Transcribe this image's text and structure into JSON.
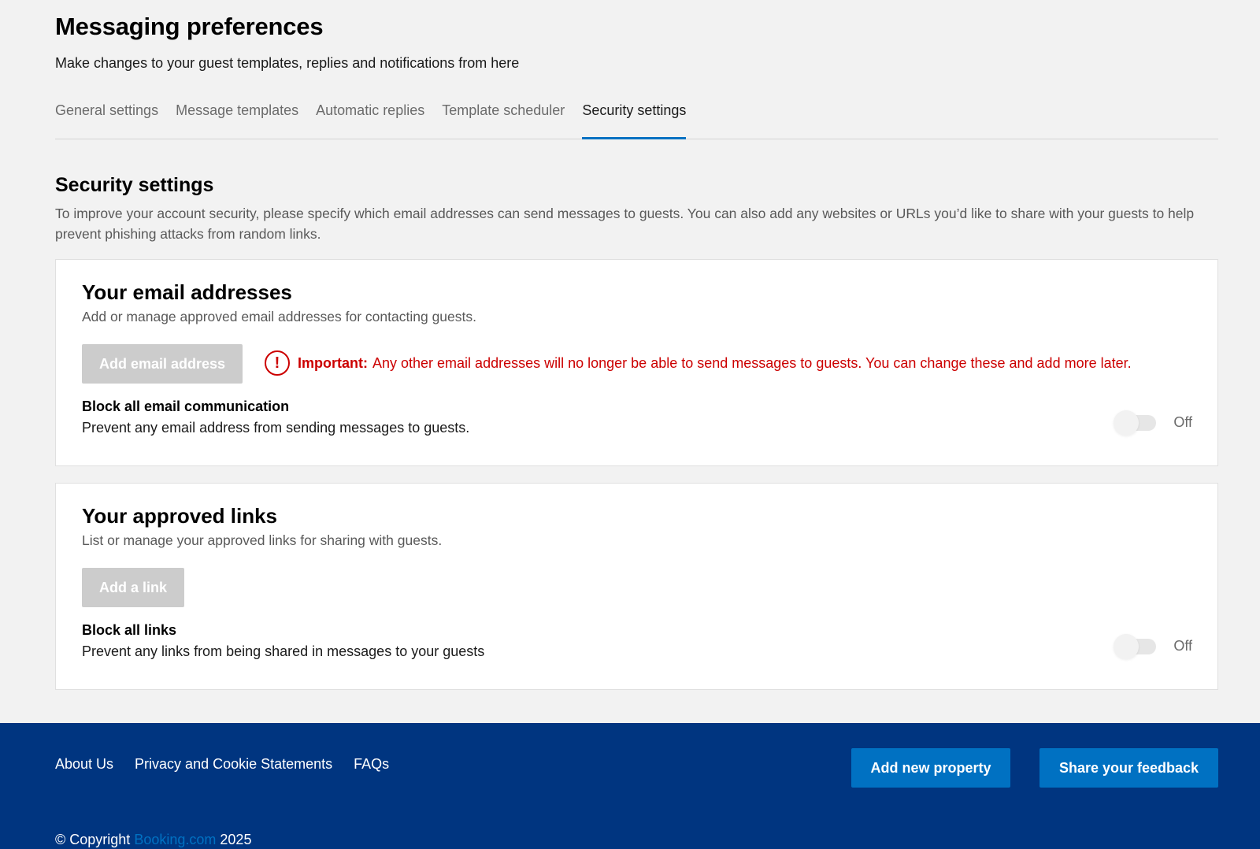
{
  "header": {
    "title": "Messaging preferences",
    "subtitle": "Make changes to your guest templates, replies and notifications from here"
  },
  "tabs": [
    {
      "label": "General settings"
    },
    {
      "label": "Message templates"
    },
    {
      "label": "Automatic replies"
    },
    {
      "label": "Template scheduler"
    },
    {
      "label": "Security settings",
      "active": true
    }
  ],
  "section": {
    "title": "Security settings",
    "description": "To improve your account security, please specify which email addresses can send messages to guests. You can also add any websites or URLs you’d like to share with your guests to help prevent phishing attacks from random links."
  },
  "email_card": {
    "title": "Your email addresses",
    "description": "Add or manage approved email addresses for contacting guests.",
    "add_button": "Add email address",
    "warning_icon": "!",
    "warning_strong": "Important:",
    "warning_text": "Any other email addresses will no longer be able to send messages to guests. You can change these and add more later.",
    "toggle_label": "Block all email communication",
    "toggle_desc": "Prevent any email address from sending messages to guests.",
    "toggle_state": "Off"
  },
  "links_card": {
    "title": "Your approved links",
    "description": "List or manage your approved links for sharing with guests.",
    "add_button": "Add a link",
    "toggle_label": "Block all links",
    "toggle_desc": "Prevent any links from being shared in messages to your guests",
    "toggle_state": "Off"
  },
  "footer": {
    "links": [
      "About Us",
      "Privacy and Cookie Statements",
      "FAQs"
    ],
    "add_property": "Add new property",
    "share_feedback": "Share your feedback",
    "copyright_prefix": "© Copyright",
    "copyright_brand": "Booking.com",
    "copyright_year": "2025"
  },
  "colors": {
    "accent": "#0071c2",
    "footer_bg": "#003580",
    "warning": "#cc0000",
    "page_bg": "#f2f2f2"
  }
}
